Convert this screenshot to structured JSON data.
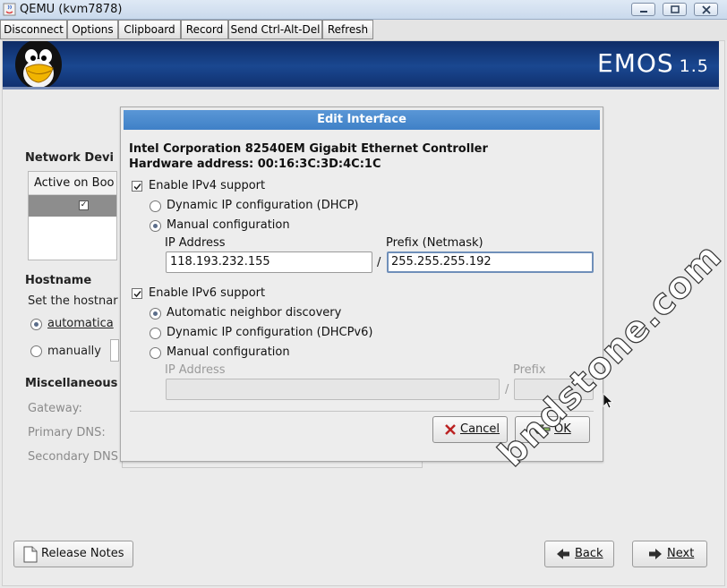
{
  "window": {
    "title": "QEMU (kvm7878)"
  },
  "toolbar": {
    "buttons": [
      "Disconnect",
      "Options",
      "Clipboard",
      "Record",
      "Send Ctrl-Alt-Del",
      "Refresh"
    ]
  },
  "banner": {
    "brand": "EMOS",
    "version": "1.5"
  },
  "background": {
    "network_devices_heading": "Network Devi",
    "list_header": "Active on Boo",
    "hostname_heading": "Hostname",
    "hostname_prompt": "Set the hostnar",
    "automatic_option": "automatica",
    "manual_option": "manually",
    "misc_heading": "Miscellaneous",
    "gateway_label": "Gateway:",
    "primary_dns_label": "Primary DNS:",
    "secondary_dns_label": "Secondary DNS"
  },
  "dialog": {
    "title": "Edit Interface",
    "device_name": "Intel Corporation 82540EM Gigabit Ethernet Controller",
    "hardware_address": "Hardware address: 00:16:3C:3D:4C:1C",
    "ipv4": {
      "enable_label": "Enable IPv4 support",
      "enabled": true,
      "dhcp_label": "Dynamic IP configuration (DHCP)",
      "manual_label": "Manual configuration",
      "selected": "manual",
      "ip_label": "IP Address",
      "ip_value": "118.193.232.155",
      "separator": "/",
      "prefix_label": "Prefix (Netmask)",
      "prefix_value": "255.255.255.192"
    },
    "ipv6": {
      "enable_label": "Enable IPv6 support",
      "enabled": true,
      "auto_label": "Automatic neighbor discovery",
      "dhcp_label": "Dynamic IP configuration (DHCPv6)",
      "manual_label": "Manual configuration",
      "selected": "auto",
      "ip_label": "IP Address",
      "separator": "/",
      "prefix_label": "Prefix"
    },
    "cancel_label": "Cancel",
    "ok_label": "OK"
  },
  "footer": {
    "release_notes_label": "Release Notes",
    "back_label": "Back",
    "next_label": "Next"
  },
  "watermark": "bndstone.com",
  "colors": {
    "banner": "#1a4790",
    "dialog_title": "#4a8bcf",
    "focus_border": "#6f8fb9"
  }
}
